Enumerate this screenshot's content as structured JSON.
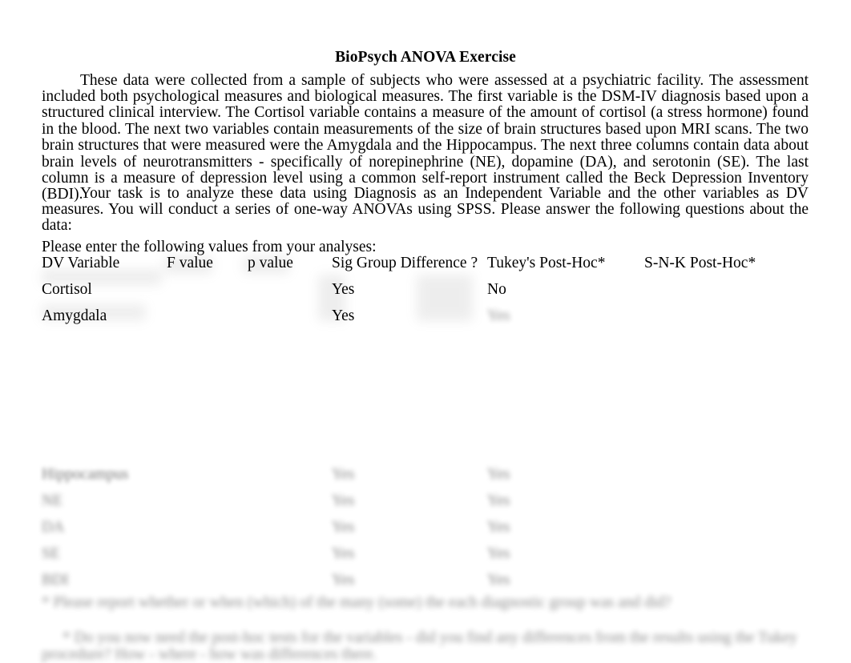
{
  "document": {
    "title": "BioPsych ANOVA Exercise",
    "paragraphs": [
      "These data were collected from a sample of subjects who were assessed at a psychiatric facility.   The assessment included both psychological measures and biological measures.  The first variable is the DSM-IV diagnosis based upon a structured clinical interview.  The Cortisol variable contains a measure of the amount of cortisol (a stress hormone) found in the blood.  The next two variables contain measurements of the size of brain structures based upon MRI scans.  The two brain structures that were measured were the Amygdala and the Hippocampus.  The next three columns contain data about brain levels of neurotransmitters - specifically of norepinephrine (NE), dopamine (DA), and serotonin (SE).  The last column is a measure of depression level using a common self-report instrument called the Beck Depression Inventory (BDI).",
      "Your task is to analyze these data using Diagnosis as an Independent Variable and the other variables as DV measures.    You will conduct a series of one-way ANOVAs using SPSS.   Please answer the following questions about the data:"
    ],
    "prompt": "Please enter the following values from your analyses:"
  },
  "table": {
    "headers": {
      "dv": "DV Variable",
      "f": "F value",
      "p": "p value",
      "sig": "Sig Group Difference  ?",
      "tukey": "Tukey's Post-Hoc*",
      "snk": "S-N-K Post-Hoc*"
    },
    "rows": [
      {
        "dv": "Cortisol",
        "f": "",
        "p": "",
        "sig": "Yes",
        "tukey": "No",
        "snk": ""
      },
      {
        "dv": "Amygdala",
        "f": "",
        "p": "",
        "sig": "Yes",
        "tukey": "Yes",
        "snk": ""
      },
      {
        "dv": "Hippocampus",
        "f": "",
        "p": "",
        "sig": "Yes",
        "tukey": "Yes",
        "snk": ""
      },
      {
        "dv": "NE",
        "f": "",
        "p": "",
        "sig": "Yes",
        "tukey": "Yes",
        "snk": ""
      },
      {
        "dv": "DA",
        "f": "",
        "p": "",
        "sig": "Yes",
        "tukey": "Yes",
        "snk": ""
      },
      {
        "dv": "SE",
        "f": "",
        "p": "",
        "sig": "Yes",
        "tukey": "Yes",
        "snk": ""
      },
      {
        "dv": "BDI",
        "f": "",
        "p": "",
        "sig": "Yes",
        "tukey": "Yes",
        "snk": ""
      }
    ]
  },
  "footnotes": [
    "*  Please report whether or when (which) of the many (some) the each diagnostic group was and did?",
    "*  Do you now need the post-hoc tests for the variables - did you find any differences from the results using the Tukey procedure? How - where - how was differences there."
  ]
}
